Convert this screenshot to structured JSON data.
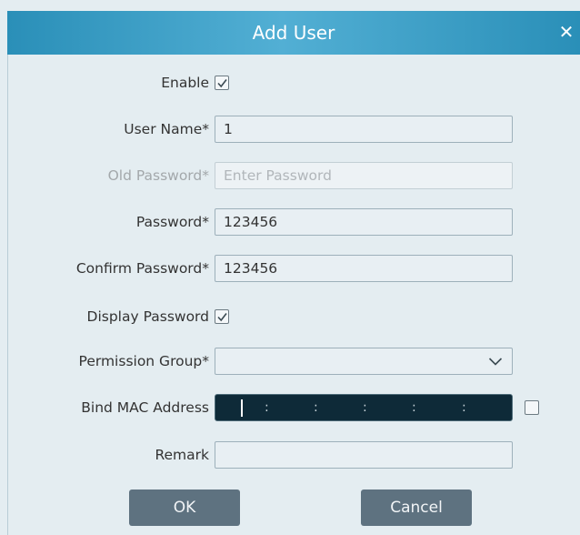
{
  "dialog": {
    "title": "Add User",
    "close_label": "✕"
  },
  "form": {
    "enable": {
      "label": "Enable",
      "checked": true
    },
    "user_name": {
      "label": "User Name*",
      "value": "1"
    },
    "old_password": {
      "label": "Old Password*",
      "placeholder": "Enter Password",
      "disabled": true
    },
    "password": {
      "label": "Password*",
      "value": "123456"
    },
    "confirm_password": {
      "label": "Confirm Password*",
      "value": "123456"
    },
    "display_password": {
      "label": "Display Password",
      "checked": true
    },
    "permission_group": {
      "label": "Permission Group*",
      "value": ""
    },
    "bind_mac": {
      "label": "Bind MAC Address",
      "separators": [
        ":",
        ":",
        ":",
        ":",
        ":"
      ],
      "checked": false
    },
    "remark": {
      "label": "Remark",
      "value": ""
    }
  },
  "buttons": {
    "ok": "OK",
    "cancel": "Cancel"
  },
  "icons": {
    "close": "close-icon",
    "checkbox_check": "checkmark-icon",
    "dropdown": "chevron-down-icon"
  },
  "colors": {
    "title_bar": "#3ea2ca",
    "button": "#5e7280",
    "mac_field": "#0e2a38"
  }
}
